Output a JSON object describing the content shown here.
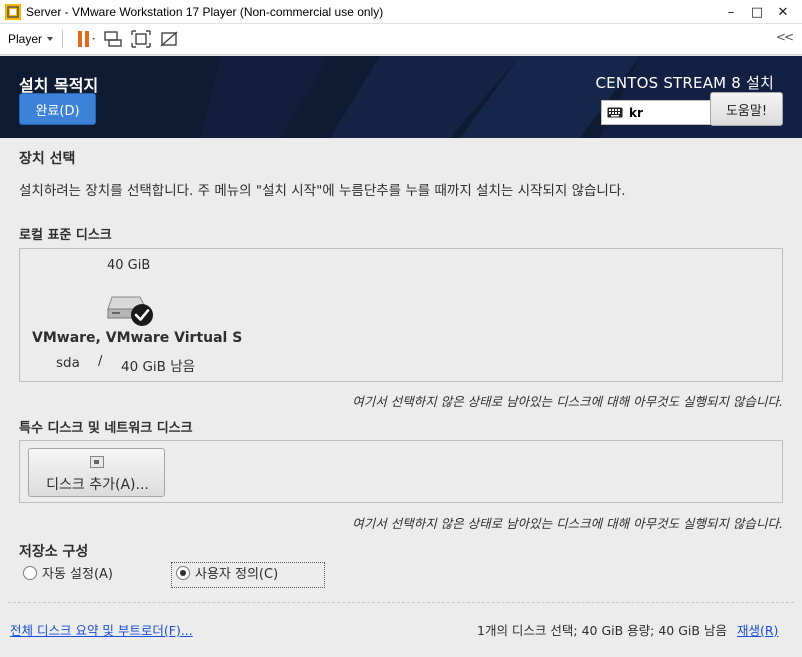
{
  "window": {
    "title": "Server - VMware Workstation 17 Player (Non-commercial use only)",
    "minimize": "–",
    "maximize": "□",
    "close": "✕"
  },
  "toolbar": {
    "player_menu": "Player",
    "collapse": "<<"
  },
  "header": {
    "page_title": "설치 목적지",
    "done_button": "완료(D)",
    "product_title": "CENTOS STREAM 8 설치",
    "keyboard_layout": "kr",
    "help_button": "도움말!"
  },
  "device_selection": {
    "heading": "장치 선택",
    "description": "설치하려는 장치를 선택합니다. 주 메뉴의 \"설치 시작\"에 누름단추를 누를 때까지 설치는 시작되지 않습니다."
  },
  "local_disks": {
    "heading": "로컬 표준 디스크",
    "disk": {
      "size": "40 GiB",
      "name": "VMware, VMware Virtual S",
      "device": "sda",
      "separator": "/",
      "free": "40 GiB 남음",
      "selected": true
    },
    "note": "여기서 선택하지 않은 상태로 남아있는 디스크에 대해 아무것도 실행되지 않습니다."
  },
  "special_disks": {
    "heading": "특수 디스크 및 네트워크 디스크",
    "add_button": "디스크 추가(A)...",
    "note": "여기서 선택하지 않은 상태로 남아있는 디스크에 대해 아무것도 실행되지 않습니다."
  },
  "storage_config": {
    "heading": "저장소 구성",
    "options": [
      {
        "label": "자동 설정(A)",
        "selected": false
      },
      {
        "label": "사용자 정의(C)",
        "selected": true
      }
    ]
  },
  "footer": {
    "summary_link": "전체 디스크 요약 및 부트로더(F)...",
    "summary_text": "1개의 디스크 선택; 40 GiB 용량; 40 GiB 남음",
    "rescan_link": "재생(R)"
  },
  "colors": {
    "banner": "#0f1a33",
    "accent_button": "#3c82d8",
    "link": "#1a4fd8"
  }
}
